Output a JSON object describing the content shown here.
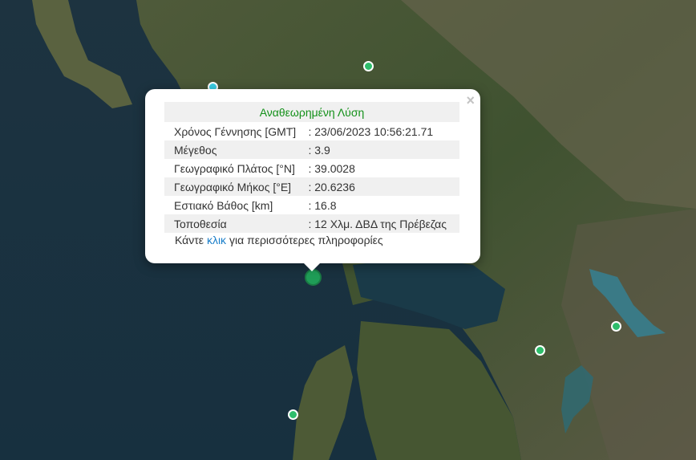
{
  "popup": {
    "title": "Αναθεωρημένη Λύση",
    "close": "×",
    "rows": [
      {
        "label": "Χρόνος Γέννησης [GMT]",
        "value": ": 23/06/2023 10:56:21.71"
      },
      {
        "label": "Μέγεθος",
        "value": ": 3.9"
      },
      {
        "label": "Γεωγραφικό Πλάτος [°N]",
        "value": ": 39.0028"
      },
      {
        "label": "Γεωγραφικό Μήκος [°E]",
        "value": ": 20.6236"
      },
      {
        "label": "Εστιακό Βάθος [km]",
        "value": ": 16.8"
      },
      {
        "label": "Τοποθεσία",
        "value": ": 12 Χλμ. ΔΒΔ της Πρέβεζας"
      }
    ],
    "more_prefix": "Κάντε",
    "more_link": "κλικ",
    "more_suffix": "για περισσότερες πληροφορίες"
  },
  "colors": {
    "title": "#139019",
    "link": "#1a7ec9",
    "marker": "#2ebd6b",
    "marker_main": "#1f9d57"
  }
}
